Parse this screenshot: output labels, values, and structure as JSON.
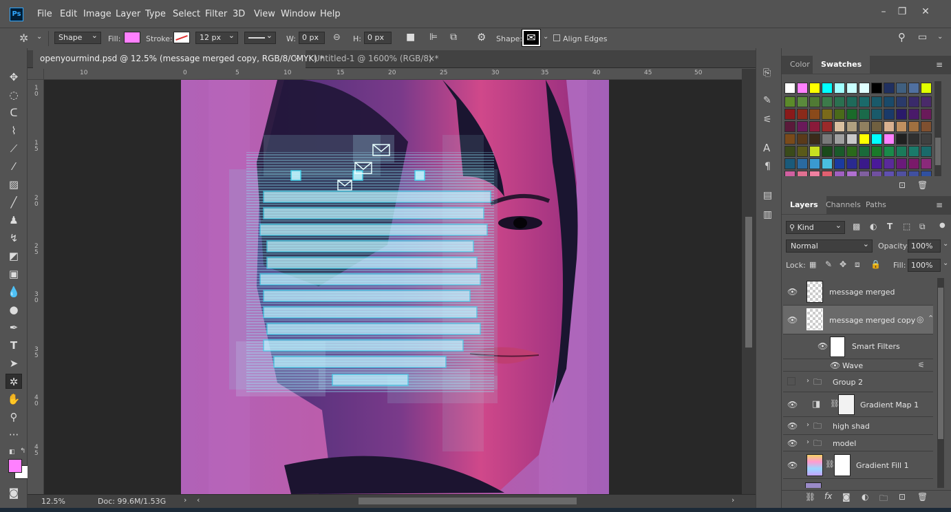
{
  "app": {
    "logo_text": "Ps"
  },
  "menu": [
    "File",
    "Edit",
    "Image",
    "Layer",
    "Type",
    "Select",
    "Filter",
    "3D",
    "View",
    "Window",
    "Help"
  ],
  "options": {
    "mode": "Shape",
    "fill_label": "Fill:",
    "fill_color": "#ff80ff",
    "stroke_label": "Stroke:",
    "stroke_size": "12 px",
    "w_label": "W:",
    "w_value": "0 px",
    "h_label": "H:",
    "h_value": "0 px",
    "shape_label": "Shape:",
    "align_edges": "Align Edges"
  },
  "tabs": [
    {
      "label": "openyourmind.psd @ 12.5% (message merged copy, RGB/8/CMYK) *",
      "active": true
    },
    {
      "label": "Untitled-1 @ 1600% (RGB/8) *",
      "active": false
    }
  ],
  "ruler_top": [
    "10",
    "0",
    "5",
    "10",
    "15",
    "20",
    "25",
    "30",
    "35",
    "40",
    "45",
    "50"
  ],
  "ruler_left": [
    "1 0",
    "1 5",
    "2 0",
    "2 5",
    "3 0",
    "3 5",
    "4 0",
    "4 5"
  ],
  "status": {
    "zoom": "12.5%",
    "doc": "Doc: 99.6M/1.53G"
  },
  "colors": {
    "foreground": "#ff80ff",
    "background": "#ffffff"
  },
  "panels": {
    "top_tabs": [
      "Color",
      "Swatches"
    ],
    "layers_tabs": [
      "Layers",
      "Channels",
      "Paths"
    ],
    "filter_kind": "Kind",
    "blend_mode": "Normal",
    "opacity_label": "Opacity:",
    "opacity_value": "100%",
    "lock_label": "Lock:",
    "fill_label": "Fill:",
    "fill_value": "100%"
  },
  "layers": [
    {
      "name": "message merged"
    },
    {
      "name": "message merged copy"
    },
    {
      "name": "Smart Filters"
    },
    {
      "name": "Wave"
    },
    {
      "name": "Group 2"
    },
    {
      "name": "Gradient Map 1"
    },
    {
      "name": "high shad"
    },
    {
      "name": "model"
    },
    {
      "name": "Gradient Fill 1"
    }
  ]
}
